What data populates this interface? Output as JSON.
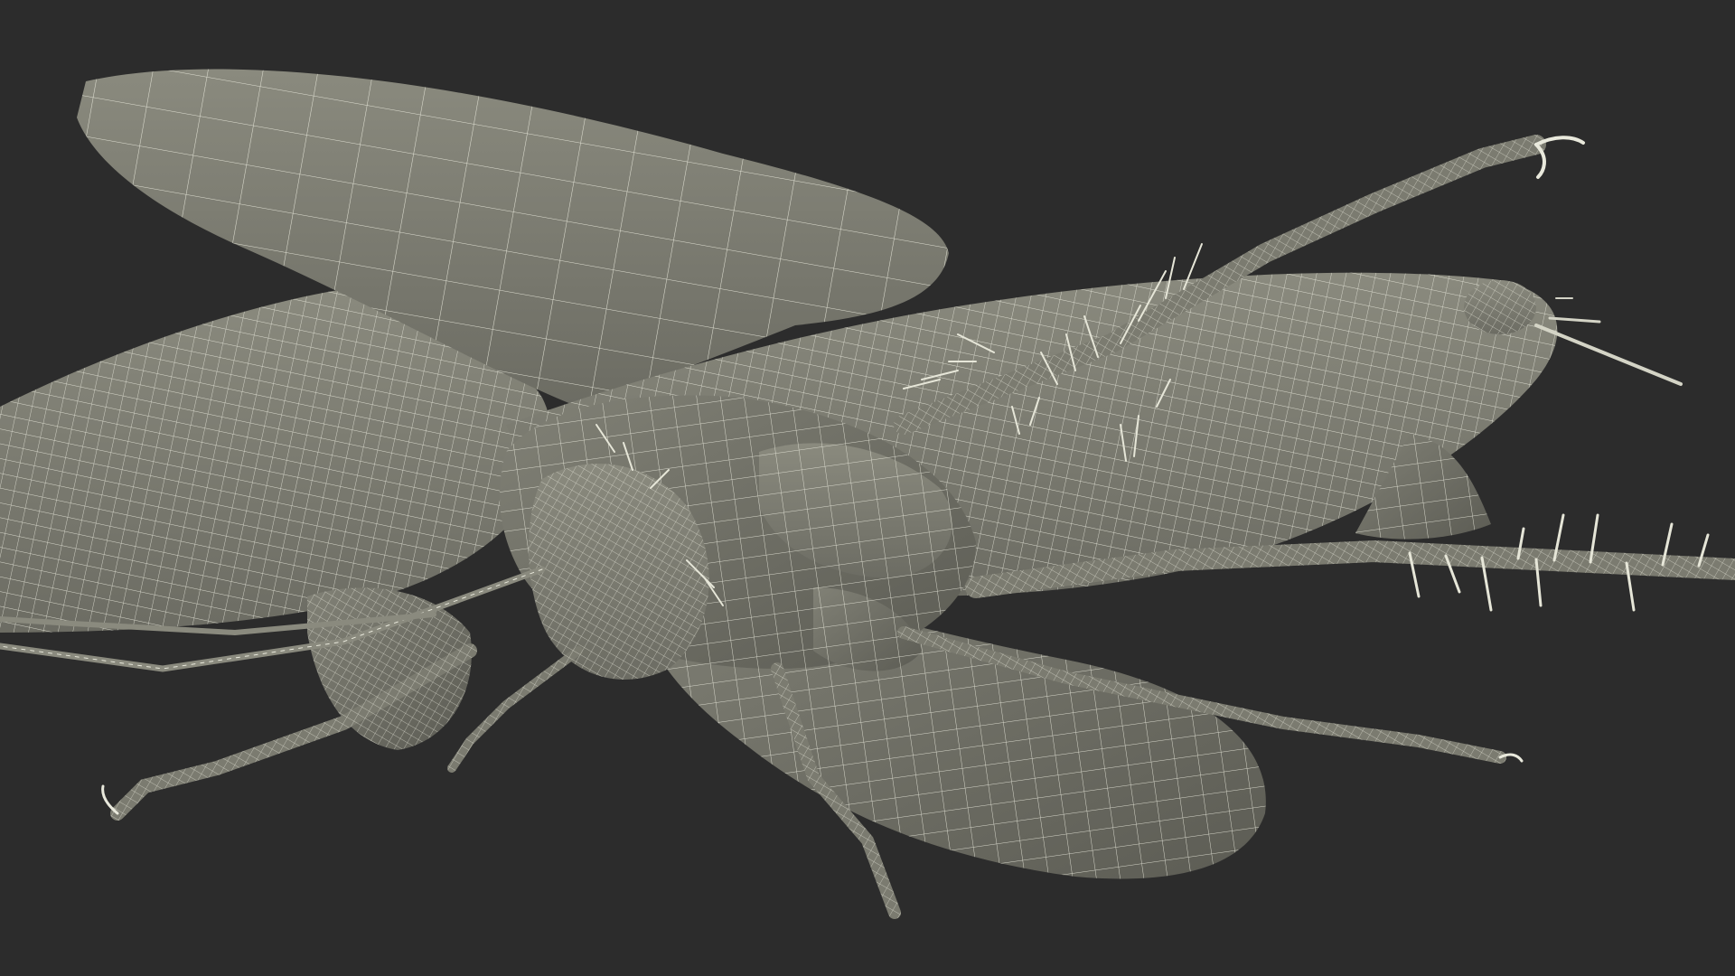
{
  "viewport": {
    "background": "#2c2c2c",
    "shading": "#7b7b70",
    "shading_light": "#8c8c80",
    "shading_dark": "#5f5f56",
    "wire": "#e9e9dc"
  },
  "model": {
    "subject": "cockroach-wireframe",
    "view": "underside",
    "display_mode": "wireframe-on-shaded"
  }
}
